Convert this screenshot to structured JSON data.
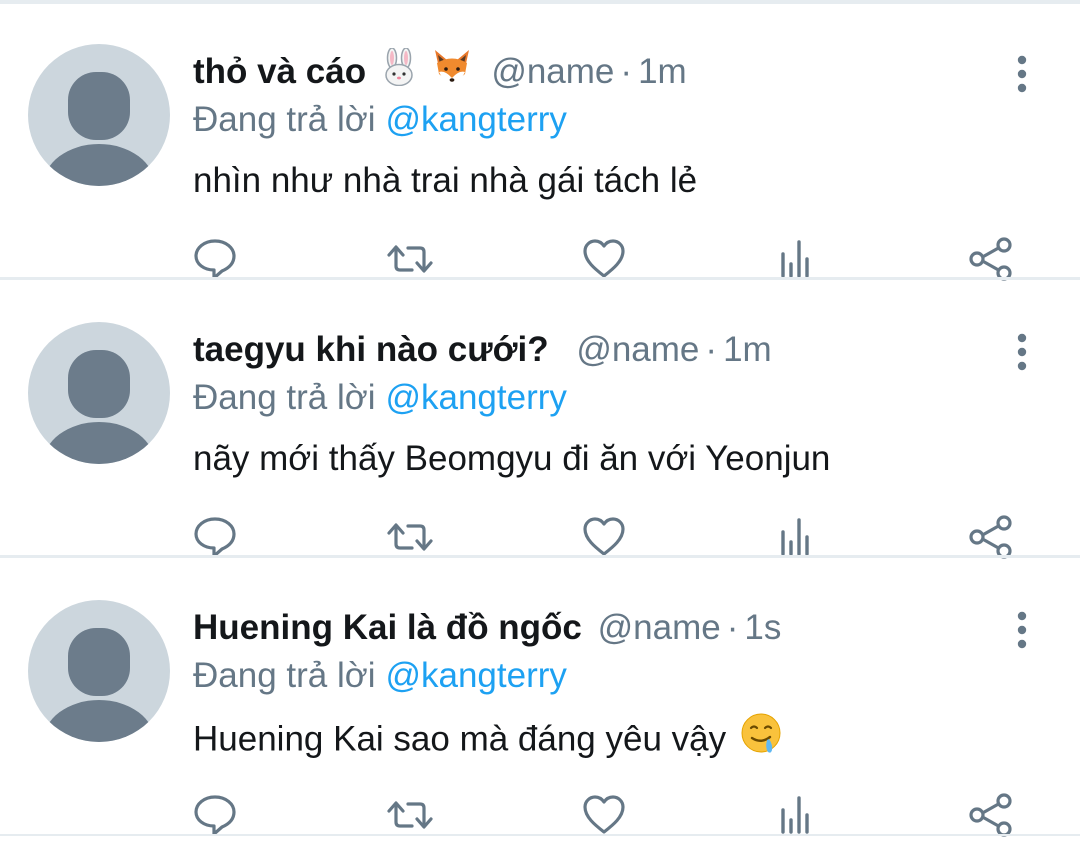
{
  "colors": {
    "text_primary": "#14171a",
    "text_secondary": "#657786",
    "accent": "#1da1f2",
    "divider": "#e6ecf0",
    "avatar_bg": "#ccd6dd",
    "avatar_fg": "#6c7c8b",
    "action_icon": "#657786"
  },
  "icons": {
    "reply": "speech-bubble-icon",
    "retweet": "retweet-icon",
    "like": "heart-icon",
    "analytics": "bar-chart-icon",
    "share": "share-icon",
    "more": "vertical-ellipsis-icon"
  },
  "tweets": [
    {
      "display_name": "thỏ và cáo",
      "name_emojis": [
        "rabbit-face-emoji",
        "fox-face-emoji"
      ],
      "handle": "@name",
      "separator": "·",
      "time": "1m",
      "reply_prefix": "Đang trả lời",
      "reply_target": "@kangterry",
      "text": "nhìn như nhà trai nhà gái tách lẻ",
      "text_emoji": ""
    },
    {
      "display_name": "taegyu khi nào cưới?",
      "name_emojis": [],
      "handle": "@name",
      "separator": "·",
      "time": "1m",
      "reply_prefix": "Đang trả lời",
      "reply_target": "@kangterry",
      "text": "nãy mới thấy Beomgyu đi ăn với Yeonjun",
      "text_emoji": ""
    },
    {
      "display_name": "Huening Kai là đồ ngốc",
      "name_emojis": [],
      "handle": "@name",
      "separator": "·",
      "time": "1s",
      "reply_prefix": "Đang trả lời",
      "reply_target": "@kangterry",
      "text": "Huening Kai sao mà đáng yêu vậy",
      "text_emoji": "drooling-face-emoji"
    }
  ]
}
